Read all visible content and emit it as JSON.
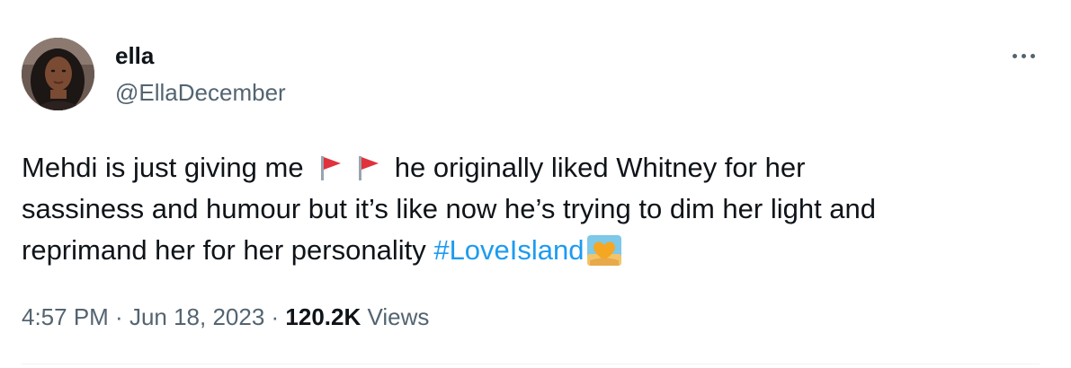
{
  "author": {
    "display_name": "ella",
    "handle": "@EllaDecember",
    "avatar_icon": "avatar-photo"
  },
  "menu": {
    "icon": "more-horizontal-icon"
  },
  "tweet": {
    "line1_before": "Mehdi is just giving me ",
    "flag_icon": "red-flag-emoji",
    "line1_after": " he originally liked Whitney for her",
    "line2": "sassiness and humour but it’s like now he’s trying to dim her light and",
    "line3_before": "reprimand her for her personality ",
    "hashtag": "#LoveIsland",
    "hashtag_emoji": "heart-on-fire-sunset-emoji"
  },
  "meta": {
    "time": "4:57 PM",
    "separator": " · ",
    "date": "Jun 18, 2023",
    "views_count": "120.2K",
    "views_label": "Views"
  },
  "colors": {
    "text": "#0f1419",
    "secondary": "#536471",
    "link": "#1d9bf0",
    "flag": "#e0323c",
    "divider": "#eff3f4"
  }
}
